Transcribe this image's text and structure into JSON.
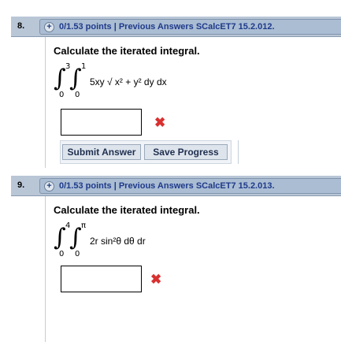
{
  "q8": {
    "number": "8.",
    "plus": "+",
    "header_text": "0/1.53 points  |  Previous Answers  SCalcET7 15.2.012.",
    "prompt": "Calculate the iterated integral.",
    "outer_upper": "3",
    "outer_lower": "0",
    "inner_upper": "1",
    "inner_lower": "0",
    "integrand": "5xy √ x² + y²  dy dx",
    "answer_value": "",
    "status_icon": "x-mark-icon",
    "submit_label": "Submit Answer",
    "save_label": "Save Progress"
  },
  "q9": {
    "number": "9.",
    "plus": "+",
    "header_text": "0/1.53 points  |  Previous Answers  SCalcET7 15.2.013.",
    "prompt": "Calculate the iterated integral.",
    "outer_upper": "4",
    "outer_lower": "0",
    "inner_upper": "π",
    "inner_lower": "0",
    "integrand": "2r sin²θ dθ dr",
    "answer_value": "",
    "status_icon": "x-mark-icon"
  },
  "colors": {
    "header_bg": "#b9c6d6",
    "header_text": "#1f3a8a",
    "wrong_mark": "#d93030"
  }
}
